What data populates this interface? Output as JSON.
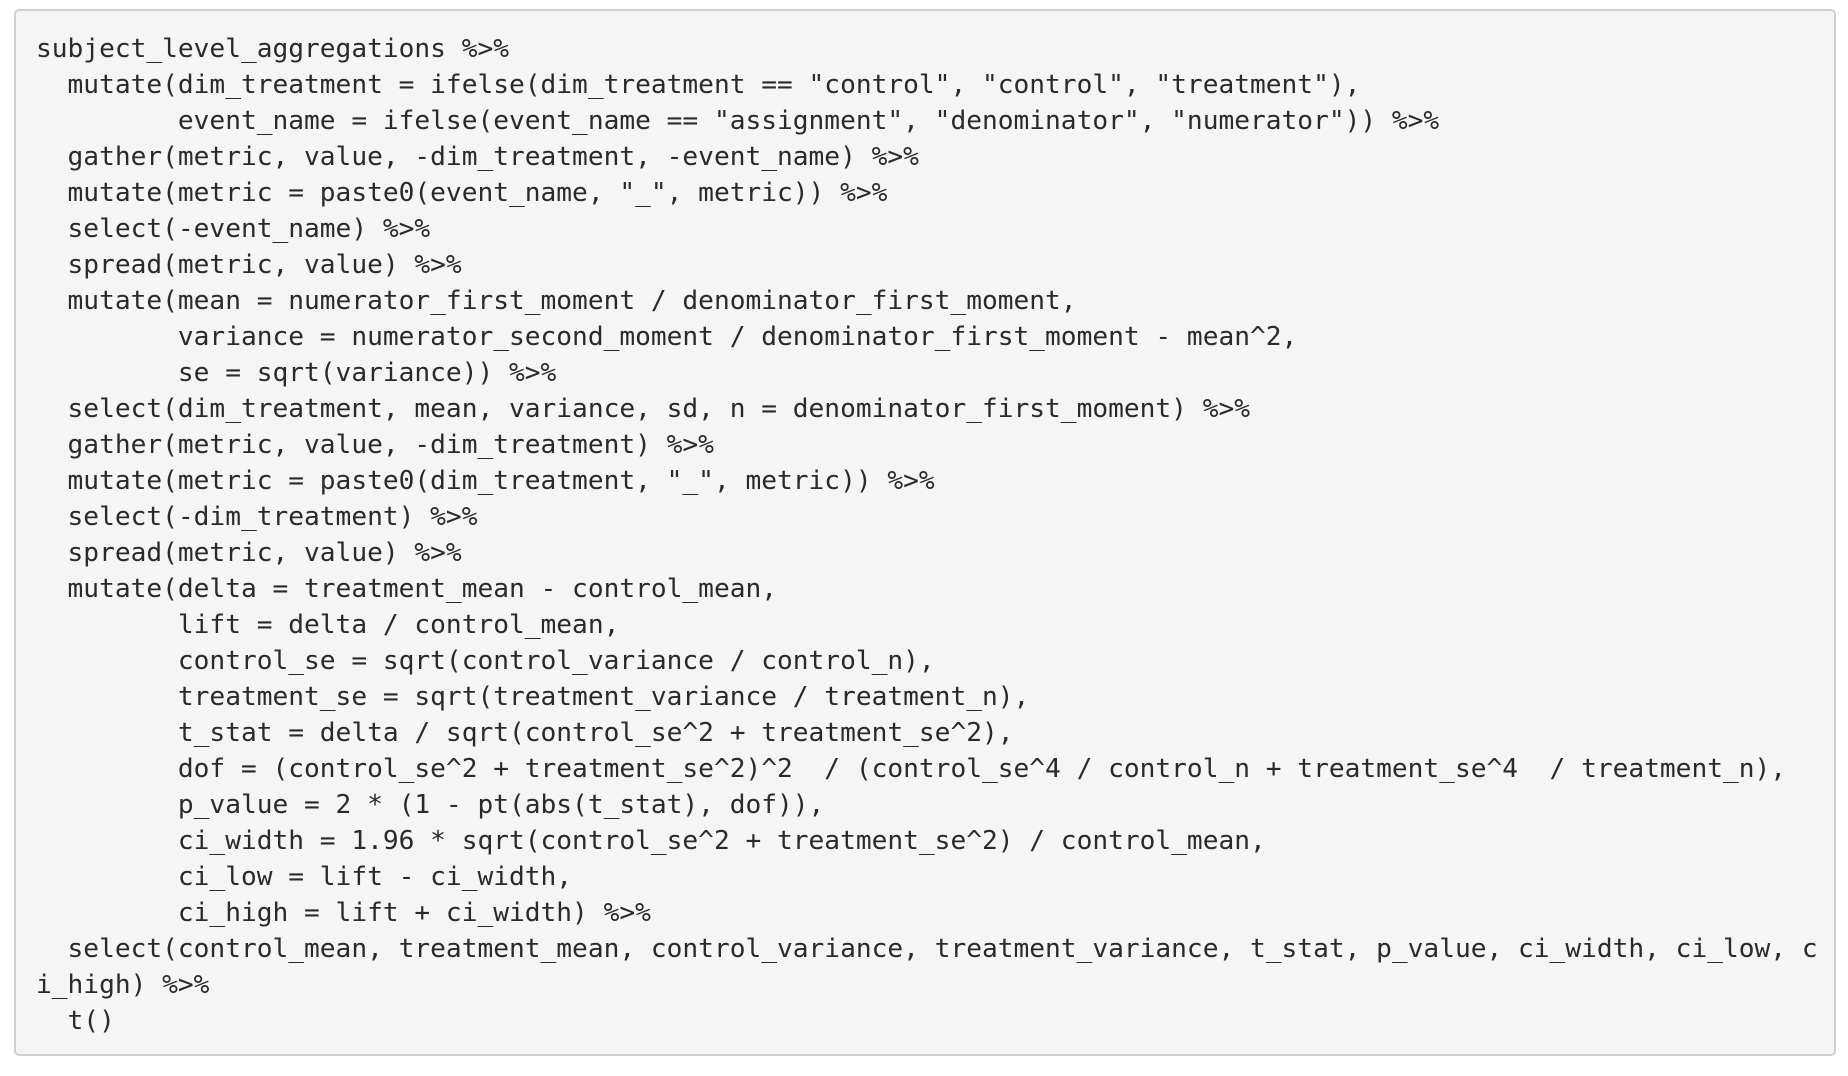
{
  "code_block": {
    "language": "R",
    "lines": [
      "subject_level_aggregations %>%",
      "  mutate(dim_treatment = ifelse(dim_treatment == \"control\", \"control\", \"treatment\"),",
      "         event_name = ifelse(event_name == \"assignment\", \"denominator\", \"numerator\")) %>%",
      "  gather(metric, value, -dim_treatment, -event_name) %>%",
      "  mutate(metric = paste0(event_name, \"_\", metric)) %>%",
      "  select(-event_name) %>%",
      "  spread(metric, value) %>%",
      "  mutate(mean = numerator_first_moment / denominator_first_moment,",
      "         variance = numerator_second_moment / denominator_first_moment - mean^2,",
      "         se = sqrt(variance)) %>%",
      "  select(dim_treatment, mean, variance, sd, n = denominator_first_moment) %>%",
      "  gather(metric, value, -dim_treatment) %>%",
      "  mutate(metric = paste0(dim_treatment, \"_\", metric)) %>%",
      "  select(-dim_treatment) %>%",
      "  spread(metric, value) %>%",
      "  mutate(delta = treatment_mean - control_mean,",
      "         lift = delta / control_mean,",
      "         control_se = sqrt(control_variance / control_n),",
      "         treatment_se = sqrt(treatment_variance / treatment_n),",
      "         t_stat = delta / sqrt(control_se^2 + treatment_se^2),",
      "         dof = (control_se^2 + treatment_se^2)^2  / (control_se^4 / control_n + treatment_se^4  / treatment_n),",
      "         p_value = 2 * (1 - pt(abs(t_stat), dof)),",
      "         ci_width = 1.96 * sqrt(control_se^2 + treatment_se^2) / control_mean,",
      "         ci_low = lift - ci_width,",
      "         ci_high = lift + ci_width) %>%",
      "  select(control_mean, treatment_mean, control_variance, treatment_variance, t_stat, p_value, ci_width, ci_low, c",
      "i_high) %>%",
      "  t()"
    ]
  },
  "colors": {
    "background": "#f5f5f5",
    "border": "#cfcfcf",
    "text": "#2a2a2a"
  }
}
